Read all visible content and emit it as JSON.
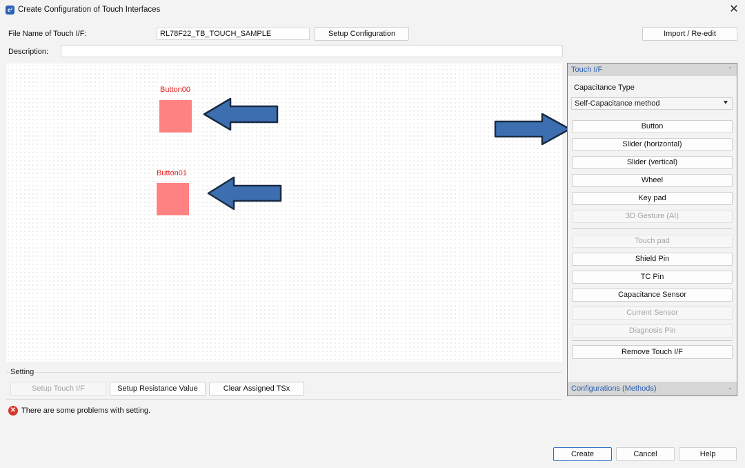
{
  "window": {
    "title": "Create Configuration of Touch Interfaces",
    "app_icon": "app-icon",
    "close_glyph": "✕"
  },
  "form": {
    "file_name_label": "File Name of Touch I/F:",
    "file_name_value": "RL78F22_TB_TOUCH_SAMPLE",
    "setup_configuration_label": "Setup Configuration",
    "import_label": "Import / Re-edit",
    "description_label": "Description:",
    "description_value": ""
  },
  "canvas": {
    "items": [
      {
        "label": "Button00",
        "color": "#ff8282"
      },
      {
        "label": "Button01",
        "color": "#ff8282"
      }
    ]
  },
  "setting": {
    "title": "Setting",
    "buttons": [
      {
        "label": "Setup Touch I/F",
        "enabled": false
      },
      {
        "label": "Setup Resistance Value",
        "enabled": true
      },
      {
        "label": "Clear Assigned TSx",
        "enabled": true
      }
    ]
  },
  "status": {
    "message": "There are some problems with setting.",
    "icon": "error-icon",
    "color": "#d6372b"
  },
  "touch_panel": {
    "header": "Touch I/F",
    "capacitance_type_label": "Capacitance Type",
    "capacitance_type_value": "Self-Capacitance method",
    "items": [
      {
        "label": "Button",
        "enabled": true
      },
      {
        "label": "Slider (horizontal)",
        "enabled": true
      },
      {
        "label": "Slider (vertical)",
        "enabled": true
      },
      {
        "label": "Wheel",
        "enabled": true
      },
      {
        "label": "Key pad",
        "enabled": true
      },
      {
        "label": "3D Gesture (AI)",
        "enabled": false
      },
      {
        "label": "Touch pad",
        "enabled": false
      },
      {
        "label": "Shield Pin",
        "enabled": true
      },
      {
        "label": "TC Pin",
        "enabled": true
      },
      {
        "label": "Capacitance Sensor",
        "enabled": true
      },
      {
        "label": "Current Sensor",
        "enabled": false
      },
      {
        "label": "Diagnosis Pin",
        "enabled": false
      },
      {
        "label": "Remove Touch I/F",
        "enabled": true
      }
    ],
    "footer": "Configurations (Methods)"
  },
  "footer_buttons": {
    "create": "Create",
    "cancel": "Cancel",
    "help": "Help"
  },
  "annotations": {
    "arrow_color": "#3d6fb0"
  }
}
